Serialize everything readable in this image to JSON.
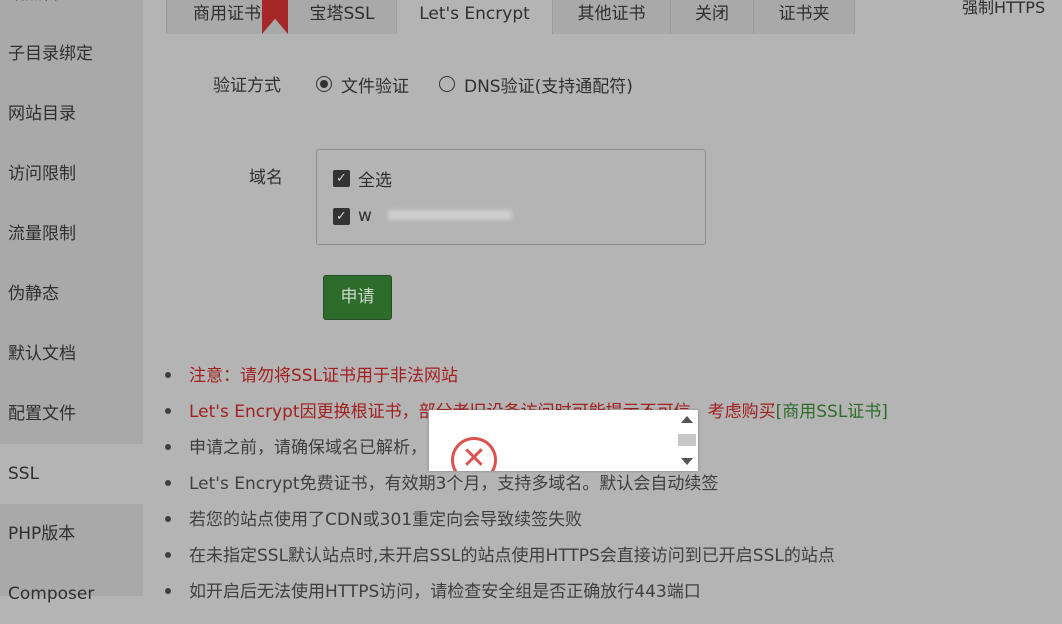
{
  "sidebar": {
    "items": [
      {
        "label": "站点管理"
      },
      {
        "label": "子目录绑定"
      },
      {
        "label": "网站目录"
      },
      {
        "label": "访问限制"
      },
      {
        "label": "流量限制"
      },
      {
        "label": "伪静态"
      },
      {
        "label": "默认文档"
      },
      {
        "label": "配置文件"
      },
      {
        "label": "SSL",
        "active": true
      },
      {
        "label": "PHP版本"
      },
      {
        "label": "Composer"
      }
    ]
  },
  "tabs": [
    {
      "label": "商用证书"
    },
    {
      "label": "宝塔SSL"
    },
    {
      "label": "Let's Encrypt",
      "active": true
    },
    {
      "label": "其他证书"
    },
    {
      "label": "关闭"
    },
    {
      "label": "证书夹"
    }
  ],
  "force_https_label": "强制HTTPS",
  "form": {
    "verify_label": "验证方式",
    "verify_options": [
      {
        "label": "文件验证",
        "checked": true
      },
      {
        "label": "DNS验证(支持通配符)",
        "checked": false
      }
    ],
    "domain_label": "域名",
    "select_all_label": "全选",
    "domain_value": "w",
    "apply_button": "申请"
  },
  "notes": {
    "n1": "注意：请勿将SSL证书用于非法网站",
    "n2_text": "Let's Encrypt因更换根证书，部分老旧设备访问时可能提示不可信，考虑购买",
    "n2_link": "[商用SSL证书]",
    "n3": "申请之前，请确保域名已解析，",
    "n4": "Let's Encrypt免费证书，有效期3个月，支持多域名。默认会自动续签",
    "n5": "若您的站点使用了CDN或301重定向会导致续签失败",
    "n6": "在未指定SSL默认站点时,未开启SSL的站点使用HTTPS会直接访问到已开启SSL的站点",
    "n7": "如开启后无法使用HTTPS访问，请检查安全组是否正确放行443端口"
  },
  "colors": {
    "apply_button_bg": "#2e6c2b",
    "warning_text": "#a12020",
    "link_text": "#2e6c2b",
    "error_icon": "#d9534f"
  },
  "icons": {
    "popup_icon": "error-x-icon",
    "scroll_up": "scroll-up-arrow-icon",
    "scroll_down": "scroll-down-arrow-icon"
  }
}
